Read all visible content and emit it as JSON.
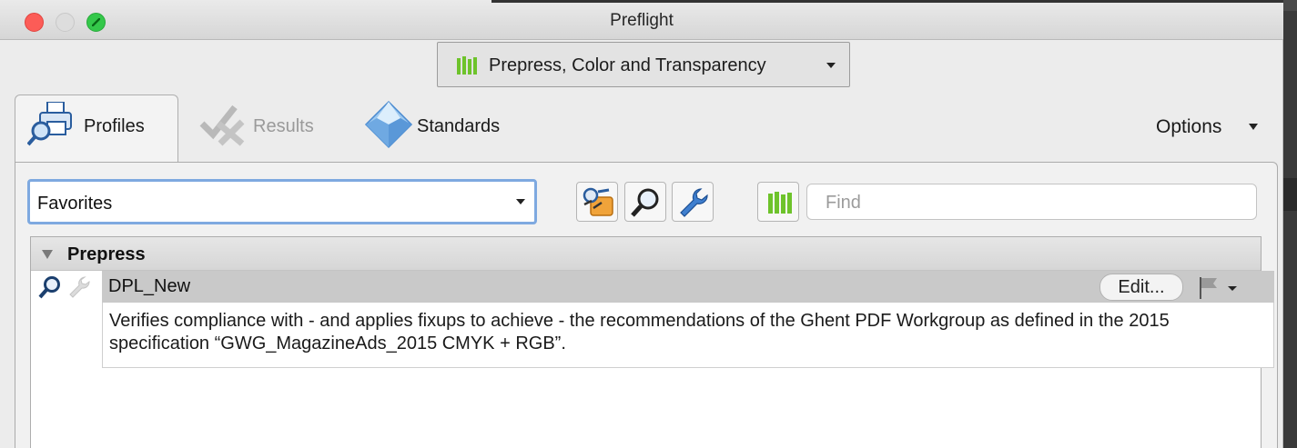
{
  "window": {
    "title": "Preflight"
  },
  "profile_select": {
    "value": "Prepress, Color and Transparency",
    "icon": "green-bars-icon"
  },
  "tabs": [
    {
      "label": "Profiles",
      "icon": "printer-magnifier-icon",
      "active": true
    },
    {
      "label": "Results",
      "icon": "checkmark-cross-icon",
      "active": false
    },
    {
      "label": "Standards",
      "icon": "diamond-icon",
      "active": false
    }
  ],
  "options_label": "Options",
  "favorites_select": {
    "value": "Favorites"
  },
  "toolbar": {
    "buttons": [
      "fixup-wand-icon",
      "magnifier-icon",
      "wrench-icon",
      "green-bars-icon"
    ]
  },
  "search": {
    "placeholder": "Find",
    "value": ""
  },
  "list": {
    "group": {
      "label": "Prepress"
    },
    "item": {
      "name": "DPL_New",
      "edit_label": "Edit...",
      "description": "Verifies compliance with - and applies fixups to achieve - the recommendations of the Ghent PDF Workgroup as defined in the 2015 specification “GWG_MagazineAds_2015 CMYK + RGB”."
    }
  },
  "colors": {
    "accent_focus": "#7ea9e0",
    "green": "#6ec32b",
    "close": "#fc5c57",
    "zoom": "#34c84a"
  }
}
